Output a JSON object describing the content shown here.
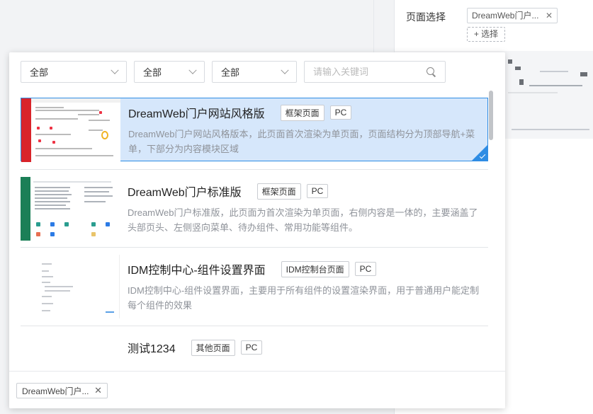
{
  "background": {
    "panel_label": "页面选择",
    "selected_tag": "DreamWeb门户...",
    "select_button": "+ 选择"
  },
  "filters": {
    "select1": "全部",
    "select2": "全部",
    "select3": "全部",
    "search_placeholder": "请输入关键词"
  },
  "items": [
    {
      "title": "DreamWeb门户网站风格版",
      "tags": [
        "框架页面",
        "PC"
      ],
      "desc": "DreamWeb门户网站风格版本，此页面首次渲染为单页面，页面结构分为顶部导航+菜单，下部分为内容模块区域",
      "selected": true
    },
    {
      "title": "DreamWeb门户标准版",
      "tags": [
        "框架页面",
        "PC"
      ],
      "desc": "DreamWeb门户标准版，此页面为首次渲染为单页面，右侧内容是一体的，主要涵盖了头部页头、左侧竖向菜单、待办组件、常用功能等组件。",
      "selected": false
    },
    {
      "title": "IDM控制中心-组件设置界面",
      "tags": [
        "IDM控制台页面",
        "PC"
      ],
      "desc": "IDM控制中心-组件设置界面，主要用于所有组件的设置渲染界面，用于普通用户能定制每个组件的效果",
      "selected": false
    },
    {
      "title": "测试1234",
      "tags": [
        "其他页面",
        "PC"
      ],
      "desc": "",
      "selected": false
    }
  ],
  "footer": {
    "selected_chip": "DreamWeb门户..."
  },
  "colors": {
    "accent": "#2f8de4",
    "selected_bg": "#d6e7fb",
    "thumb_red": "#d9242a",
    "thumb_green": "#1b7f57"
  }
}
